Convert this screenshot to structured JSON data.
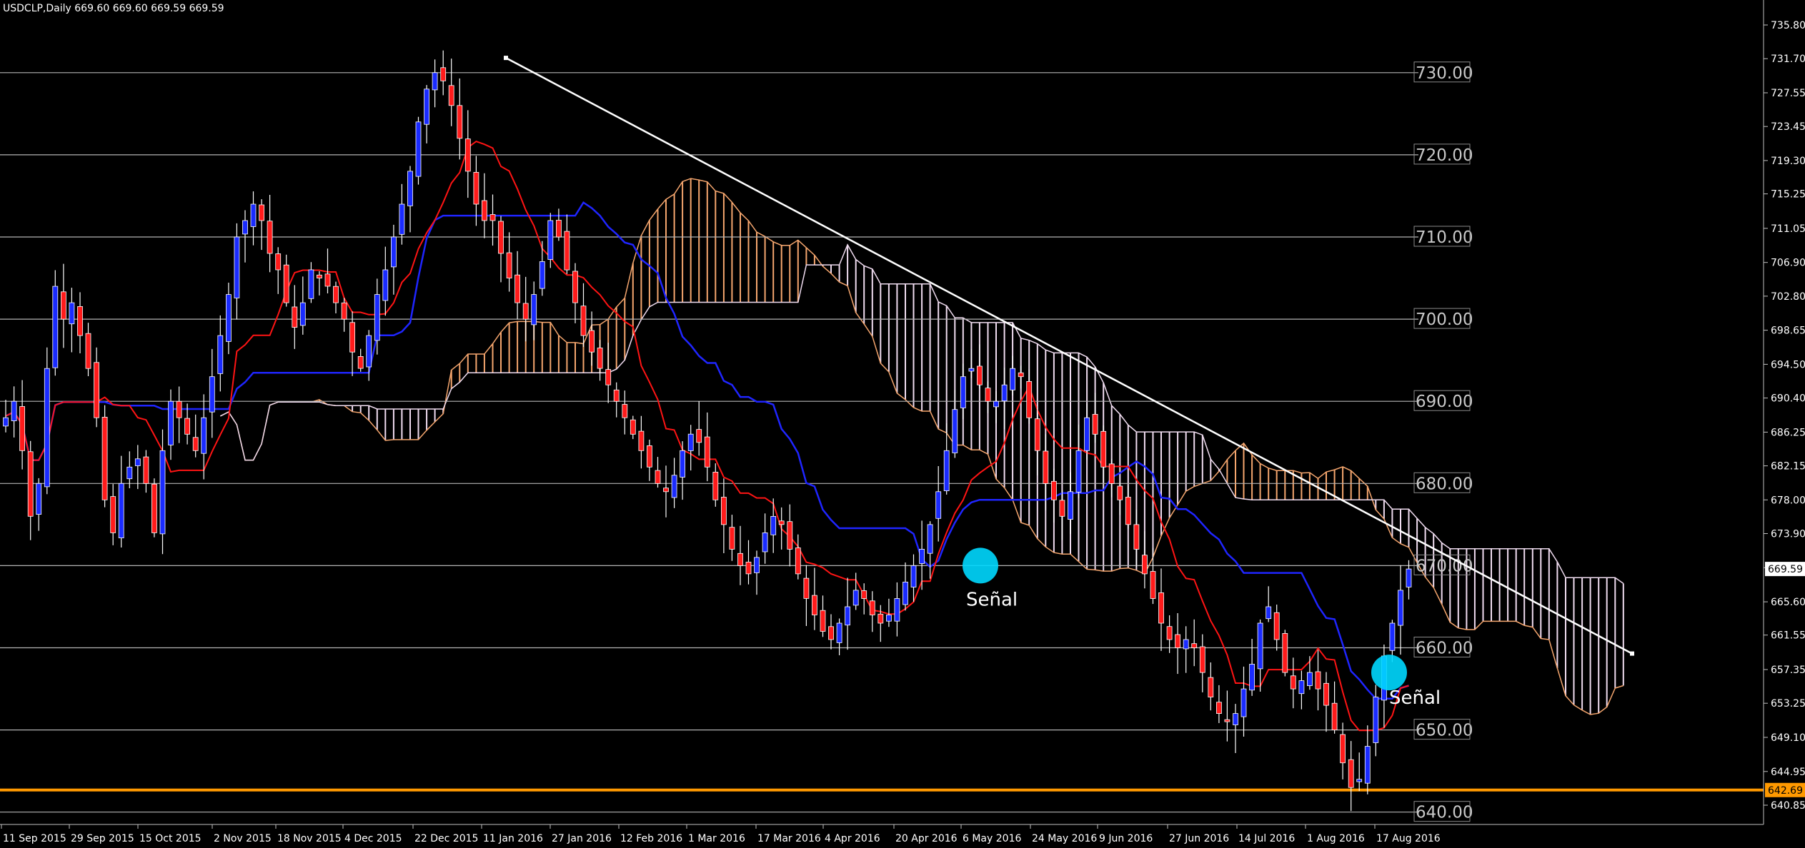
{
  "chart_info": "USDCLP,Daily  669.60 669.60 669.59 669.59",
  "colors": {
    "background": "#000000",
    "bull_candle": "#1a2bff",
    "bear_candle": "#ff1b1b",
    "tenkan": "#ff1414",
    "kijun": "#1f25ff",
    "cloud_bull": "#f5a66e",
    "cloud_bear": "#f0dcf0",
    "trendline": "#ffffff",
    "support_line": "#ff9900",
    "signal_marker": "#00d8ff",
    "level_line": "#b4b4b4"
  },
  "chart_data": {
    "type": "candlestick",
    "symbol": "USDCLP",
    "timeframe": "Daily",
    "ylim": [
      638.5,
      737.8
    ],
    "y_ticks": [
      "735.80",
      "731.70",
      "727.55",
      "723.45",
      "719.30",
      "715.25",
      "711.05",
      "706.90",
      "702.80",
      "698.65",
      "694.50",
      "690.40",
      "686.25",
      "682.15",
      "678.00",
      "673.90",
      "669.75",
      "665.60",
      "661.55",
      "657.35",
      "653.25",
      "649.10",
      "644.95",
      "640.85"
    ],
    "x_ticks": [
      "11 Sep 2015",
      "29 Sep 2015",
      "15 Oct 2015",
      "2 Nov 2015",
      "18 Nov 2015",
      "4 Dec 2015",
      "22 Dec 2015",
      "11 Jan 2016",
      "27 Jan 2016",
      "12 Feb 2016",
      "1 Mar 2016",
      "17 Mar 2016",
      "4 Apr 2016",
      "20 Apr 2016",
      "6 May 2016",
      "24 May 2016",
      "9 Jun 2016",
      "27 Jun 2016",
      "14 Jul 2016",
      "1 Aug 2016",
      "17 Aug 2016"
    ],
    "horizontal_levels": [
      "730.00",
      "720.00",
      "710.00",
      "700.00",
      "690.00",
      "680.00",
      "670.00",
      "660.00",
      "650.00",
      "640.00"
    ],
    "current_price": "669.59",
    "support_price": "642.69",
    "indicators": [
      "Ichimoku Kinko Hyo (Tenkan-sen, Kijun-sen, Kumo cloud)"
    ],
    "trendline": {
      "from": {
        "date": "11 Jan 2016",
        "price": 731.8
      },
      "to": {
        "date": "Sep 2016",
        "price": 659.3
      }
    },
    "signals": [
      {
        "label": "Señal",
        "date": "6 May 2016",
        "price": 670.0
      },
      {
        "label": "Señal",
        "date": "17 Aug 2016",
        "price": 657.0
      }
    ],
    "path": [
      688,
      690,
      684,
      676,
      680,
      694,
      704,
      700,
      702,
      698,
      694,
      688,
      678,
      674,
      680,
      682,
      683,
      680,
      674,
      684,
      690,
      688,
      686,
      684,
      688,
      693,
      698,
      703,
      710,
      712,
      714,
      712,
      708,
      706,
      702,
      699,
      702,
      706,
      705,
      704,
      702,
      700,
      696,
      694,
      698,
      703,
      706,
      710,
      714,
      718,
      724,
      728,
      730,
      729,
      726,
      722,
      718,
      714,
      712,
      712,
      708,
      705,
      702,
      700,
      703,
      707,
      712,
      710,
      706,
      702,
      698,
      696,
      694,
      692,
      690,
      688,
      686,
      684,
      682,
      680,
      679,
      681,
      684,
      686,
      685,
      682,
      678,
      675,
      672,
      670,
      669,
      671,
      674,
      676,
      675,
      672,
      669,
      666,
      664,
      662,
      661,
      663,
      665,
      667,
      666,
      664,
      663,
      664,
      666,
      668,
      670,
      672,
      675,
      679,
      684,
      689,
      693,
      694,
      692,
      690,
      690,
      692,
      694,
      693,
      688,
      684,
      680,
      678,
      676,
      679,
      684,
      688,
      686,
      682,
      680,
      678,
      675,
      672,
      669,
      666,
      663,
      661,
      660,
      661,
      660,
      657,
      654,
      652,
      651,
      652,
      655,
      658,
      663,
      665,
      661,
      657,
      655,
      656,
      657,
      655,
      653,
      650,
      646,
      643,
      644,
      648,
      654,
      659,
      663,
      667,
      669.59
    ]
  },
  "signal_labels": [
    "Señal",
    "Señal"
  ]
}
